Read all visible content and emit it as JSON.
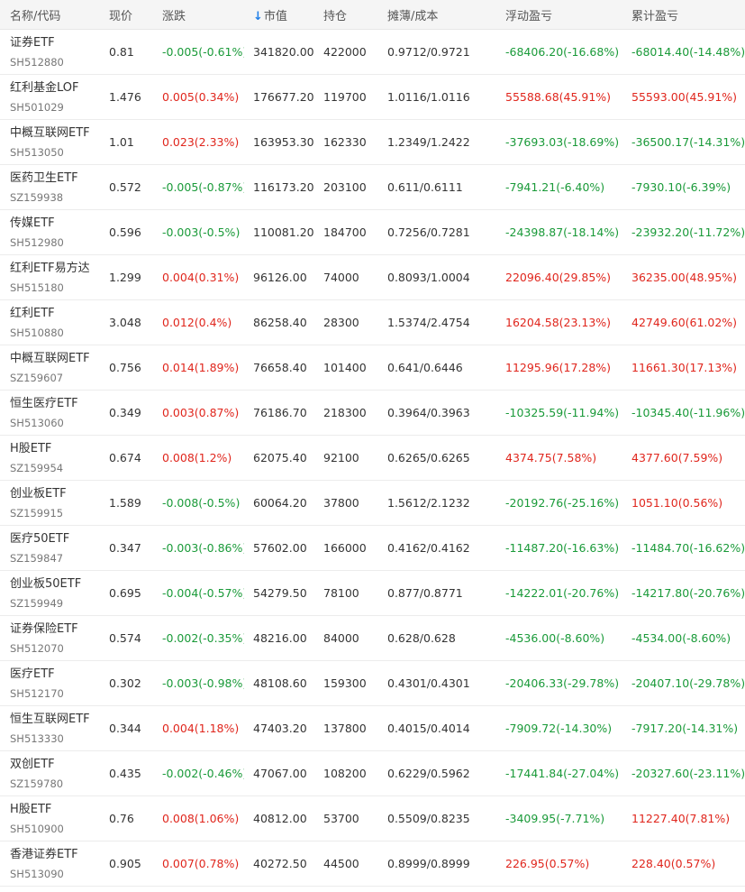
{
  "headers": {
    "name": "名称/代码",
    "price": "现价",
    "change": "涨跌",
    "market_value": "市值",
    "position": "持仓",
    "cost": "摊薄/成本",
    "float_pl": "浮动盈亏",
    "total_pl": "累计盈亏",
    "sort_icon": "↓"
  },
  "colors": {
    "up": "#e0261d",
    "down": "#1a9a39",
    "sort": "#1e7ee8"
  },
  "rows": [
    {
      "name": "证券ETF",
      "code": "SH512880",
      "price": "0.81",
      "change": "-0.005(-0.61%)",
      "change_dir": "down",
      "mv": "341820.00",
      "pos": "422000",
      "cost": "0.9712/0.9721",
      "float": "-68406.20(-16.68%)",
      "float_dir": "down",
      "total": "-68014.40(-14.48%)",
      "total_dir": "down"
    },
    {
      "name": "红利基金LOF",
      "code": "SH501029",
      "price": "1.476",
      "change": "0.005(0.34%)",
      "change_dir": "up",
      "mv": "176677.20",
      "pos": "119700",
      "cost": "1.0116/1.0116",
      "float": "55588.68(45.91%)",
      "float_dir": "up",
      "total": "55593.00(45.91%)",
      "total_dir": "up"
    },
    {
      "name": "中概互联网ETF",
      "code": "SH513050",
      "price": "1.01",
      "change": "0.023(2.33%)",
      "change_dir": "up",
      "mv": "163953.30",
      "pos": "162330",
      "cost": "1.2349/1.2422",
      "float": "-37693.03(-18.69%)",
      "float_dir": "down",
      "total": "-36500.17(-14.31%)",
      "total_dir": "down"
    },
    {
      "name": "医药卫生ETF",
      "code": "SZ159938",
      "price": "0.572",
      "change": "-0.005(-0.87%)",
      "change_dir": "down",
      "mv": "116173.20",
      "pos": "203100",
      "cost": "0.611/0.6111",
      "float": "-7941.21(-6.40%)",
      "float_dir": "down",
      "total": "-7930.10(-6.39%)",
      "total_dir": "down"
    },
    {
      "name": "传媒ETF",
      "code": "SH512980",
      "price": "0.596",
      "change": "-0.003(-0.5%)",
      "change_dir": "down",
      "mv": "110081.20",
      "pos": "184700",
      "cost": "0.7256/0.7281",
      "float": "-24398.87(-18.14%)",
      "float_dir": "down",
      "total": "-23932.20(-11.72%)",
      "total_dir": "down"
    },
    {
      "name": "红利ETF易方达",
      "code": "SH515180",
      "price": "1.299",
      "change": "0.004(0.31%)",
      "change_dir": "up",
      "mv": "96126.00",
      "pos": "74000",
      "cost": "0.8093/1.0004",
      "float": "22096.40(29.85%)",
      "float_dir": "up",
      "total": "36235.00(48.95%)",
      "total_dir": "up"
    },
    {
      "name": "红利ETF",
      "code": "SH510880",
      "price": "3.048",
      "change": "0.012(0.4%)",
      "change_dir": "up",
      "mv": "86258.40",
      "pos": "28300",
      "cost": "1.5374/2.4754",
      "float": "16204.58(23.13%)",
      "float_dir": "up",
      "total": "42749.60(61.02%)",
      "total_dir": "up"
    },
    {
      "name": "中概互联网ETF",
      "code": "SZ159607",
      "price": "0.756",
      "change": "0.014(1.89%)",
      "change_dir": "up",
      "mv": "76658.40",
      "pos": "101400",
      "cost": "0.641/0.6446",
      "float": "11295.96(17.28%)",
      "float_dir": "up",
      "total": "11661.30(17.13%)",
      "total_dir": "up"
    },
    {
      "name": "恒生医疗ETF",
      "code": "SH513060",
      "price": "0.349",
      "change": "0.003(0.87%)",
      "change_dir": "up",
      "mv": "76186.70",
      "pos": "218300",
      "cost": "0.3964/0.3963",
      "float": "-10325.59(-11.94%)",
      "float_dir": "down",
      "total": "-10345.40(-11.96%)",
      "total_dir": "down"
    },
    {
      "name": "H股ETF",
      "code": "SZ159954",
      "price": "0.674",
      "change": "0.008(1.2%)",
      "change_dir": "up",
      "mv": "62075.40",
      "pos": "92100",
      "cost": "0.6265/0.6265",
      "float": "4374.75(7.58%)",
      "float_dir": "up",
      "total": "4377.60(7.59%)",
      "total_dir": "up"
    },
    {
      "name": "创业板ETF",
      "code": "SZ159915",
      "price": "1.589",
      "change": "-0.008(-0.5%)",
      "change_dir": "down",
      "mv": "60064.20",
      "pos": "37800",
      "cost": "1.5612/2.1232",
      "float": "-20192.76(-25.16%)",
      "float_dir": "down",
      "total": "1051.10(0.56%)",
      "total_dir": "up"
    },
    {
      "name": "医疗50ETF",
      "code": "SZ159847",
      "price": "0.347",
      "change": "-0.003(-0.86%)",
      "change_dir": "down",
      "mv": "57602.00",
      "pos": "166000",
      "cost": "0.4162/0.4162",
      "float": "-11487.20(-16.63%)",
      "float_dir": "down",
      "total": "-11484.70(-16.62%)",
      "total_dir": "down"
    },
    {
      "name": "创业板50ETF",
      "code": "SZ159949",
      "price": "0.695",
      "change": "-0.004(-0.57%)",
      "change_dir": "down",
      "mv": "54279.50",
      "pos": "78100",
      "cost": "0.877/0.8771",
      "float": "-14222.01(-20.76%)",
      "float_dir": "down",
      "total": "-14217.80(-20.76%)",
      "total_dir": "down"
    },
    {
      "name": "证券保险ETF",
      "code": "SH512070",
      "price": "0.574",
      "change": "-0.002(-0.35%)",
      "change_dir": "down",
      "mv": "48216.00",
      "pos": "84000",
      "cost": "0.628/0.628",
      "float": "-4536.00(-8.60%)",
      "float_dir": "down",
      "total": "-4534.00(-8.60%)",
      "total_dir": "down"
    },
    {
      "name": "医疗ETF",
      "code": "SH512170",
      "price": "0.302",
      "change": "-0.003(-0.98%)",
      "change_dir": "down",
      "mv": "48108.60",
      "pos": "159300",
      "cost": "0.4301/0.4301",
      "float": "-20406.33(-29.78%)",
      "float_dir": "down",
      "total": "-20407.10(-29.78%)",
      "total_dir": "down"
    },
    {
      "name": "恒生互联网ETF",
      "code": "SH513330",
      "price": "0.344",
      "change": "0.004(1.18%)",
      "change_dir": "up",
      "mv": "47403.20",
      "pos": "137800",
      "cost": "0.4015/0.4014",
      "float": "-7909.72(-14.30%)",
      "float_dir": "down",
      "total": "-7917.20(-14.31%)",
      "total_dir": "down"
    },
    {
      "name": "双创ETF",
      "code": "SZ159780",
      "price": "0.435",
      "change": "-0.002(-0.46%)",
      "change_dir": "down",
      "mv": "47067.00",
      "pos": "108200",
      "cost": "0.6229/0.5962",
      "float": "-17441.84(-27.04%)",
      "float_dir": "down",
      "total": "-20327.60(-23.11%)",
      "total_dir": "down"
    },
    {
      "name": "H股ETF",
      "code": "SH510900",
      "price": "0.76",
      "change": "0.008(1.06%)",
      "change_dir": "up",
      "mv": "40812.00",
      "pos": "53700",
      "cost": "0.5509/0.8235",
      "float": "-3409.95(-7.71%)",
      "float_dir": "down",
      "total": "11227.40(7.81%)",
      "total_dir": "up"
    },
    {
      "name": "香港证券ETF",
      "code": "SH513090",
      "price": "0.905",
      "change": "0.007(0.78%)",
      "change_dir": "up",
      "mv": "40272.50",
      "pos": "44500",
      "cost": "0.8999/0.8999",
      "float": "226.95(0.57%)",
      "float_dir": "up",
      "total": "228.40(0.57%)",
      "total_dir": "up"
    }
  ]
}
